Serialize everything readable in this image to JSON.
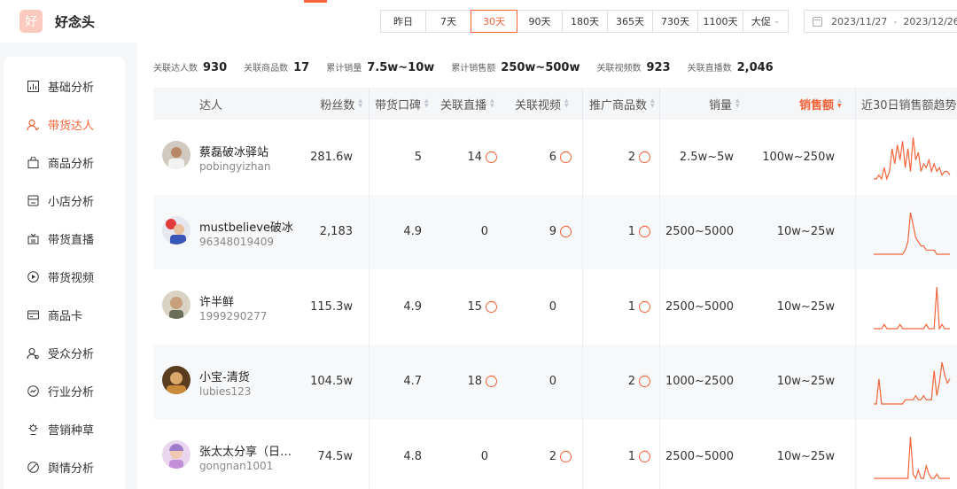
{
  "app": {
    "name": "好念头",
    "logo_char": "好"
  },
  "time_range": {
    "tabs": [
      "昨日",
      "7天",
      "30天",
      "90天",
      "180天",
      "365天",
      "730天",
      "1100天",
      "大促"
    ],
    "active": "30天",
    "start": "2023/11/27",
    "end": "2023/12/26",
    "separator": "-"
  },
  "sidebar": {
    "items": [
      {
        "label": "基础分析",
        "icon": "bar-chart-icon",
        "active": false
      },
      {
        "label": "带货达人",
        "icon": "user-icon",
        "active": true
      },
      {
        "label": "商品分析",
        "icon": "shopping-bag-icon",
        "active": false
      },
      {
        "label": "小店分析",
        "icon": "store-icon",
        "active": false
      },
      {
        "label": "带货直播",
        "icon": "live-icon",
        "active": false
      },
      {
        "label": "带货视频",
        "icon": "play-icon",
        "active": false
      },
      {
        "label": "商品卡",
        "icon": "card-icon",
        "active": false
      },
      {
        "label": "受众分析",
        "icon": "audience-icon",
        "active": false
      },
      {
        "label": "行业分析",
        "icon": "trend-icon",
        "active": false
      },
      {
        "label": "营销种草",
        "icon": "sprout-icon",
        "active": false
      },
      {
        "label": "舆情分析",
        "icon": "sentiment-icon",
        "active": false
      }
    ]
  },
  "stats": [
    {
      "label": "关联达人数",
      "value": "930"
    },
    {
      "label": "关联商品数",
      "value": "17"
    },
    {
      "label": "累计销量",
      "value": "7.5w~10w"
    },
    {
      "label": "累计销售额",
      "value": "250w~500w"
    },
    {
      "label": "关联视频数",
      "value": "923"
    },
    {
      "label": "关联直播数",
      "value": "2,046"
    }
  ],
  "table": {
    "columns": [
      "达人",
      "粉丝数",
      "带货口碑",
      "关联直播",
      "关联视频",
      "推广商品数",
      "销量",
      "销售额",
      "近30日销售额趋势"
    ],
    "sorted_column": "销售额",
    "accent": "#f4643a",
    "rows": [
      {
        "name": "蔡磊破冰驿站",
        "id": "pobingyizhan",
        "fans": "281.6w",
        "rating": "5",
        "lives": "14",
        "videos": "6",
        "products": "2",
        "sales": "2.5w~5w",
        "revenue": "100w~250w",
        "trend": [
          0,
          0,
          1,
          0,
          3,
          0,
          2,
          8,
          4,
          9,
          5,
          10,
          3,
          8,
          2,
          11,
          5,
          7,
          2,
          4,
          3,
          5,
          2,
          4,
          2,
          3,
          1,
          2,
          2,
          1
        ]
      },
      {
        "name": "mustbelieve破冰",
        "id": "96348019409",
        "fans": "2,183",
        "rating": "4.9",
        "lives": "0",
        "videos": "9",
        "products": "1",
        "sales": "2500~5000",
        "revenue": "10w~25w",
        "trend": [
          0,
          0,
          0,
          0,
          0,
          0,
          0,
          0,
          0,
          0,
          0,
          0,
          1,
          3,
          10,
          7,
          4,
          3,
          2,
          2,
          1,
          1,
          1,
          1,
          0,
          0,
          0,
          0,
          0,
          0
        ]
      },
      {
        "name": "许半鲜",
        "id": "1999290277",
        "fans": "115.3w",
        "rating": "4.9",
        "lives": "15",
        "videos": "0",
        "products": "1",
        "sales": "2500~5000",
        "revenue": "10w~25w",
        "trend": [
          0,
          0,
          0,
          0,
          1,
          0,
          0,
          0,
          0,
          0,
          1,
          0,
          0,
          0,
          0,
          0,
          0,
          0,
          0,
          0,
          1,
          0,
          0,
          0,
          10,
          0,
          1,
          0,
          0,
          0
        ]
      },
      {
        "name": "小宝-清货",
        "id": "lubies123",
        "fans": "104.5w",
        "rating": "4.7",
        "lives": "18",
        "videos": "0",
        "products": "2",
        "sales": "1000~2500",
        "revenue": "10w~25w",
        "trend": [
          0,
          0,
          6,
          0,
          0,
          0,
          0,
          0,
          0,
          0,
          0,
          0,
          1,
          1,
          1,
          1,
          2,
          1,
          1,
          2,
          1,
          1,
          1,
          8,
          2,
          5,
          10,
          7,
          5,
          6
        ]
      },
      {
        "name": "张太太分享（日…",
        "id": "gongnan1001",
        "fans": "74.5w",
        "rating": "4.8",
        "lives": "0",
        "videos": "2",
        "products": "1",
        "sales": "2500~5000",
        "revenue": "10w~25w",
        "trend": [
          0,
          0,
          0,
          0,
          0,
          0,
          0,
          0,
          0,
          0,
          0,
          0,
          0,
          0,
          10,
          1,
          0,
          2,
          0,
          0,
          3,
          1,
          0,
          0,
          1,
          0,
          0,
          0,
          0,
          0
        ]
      }
    ]
  }
}
